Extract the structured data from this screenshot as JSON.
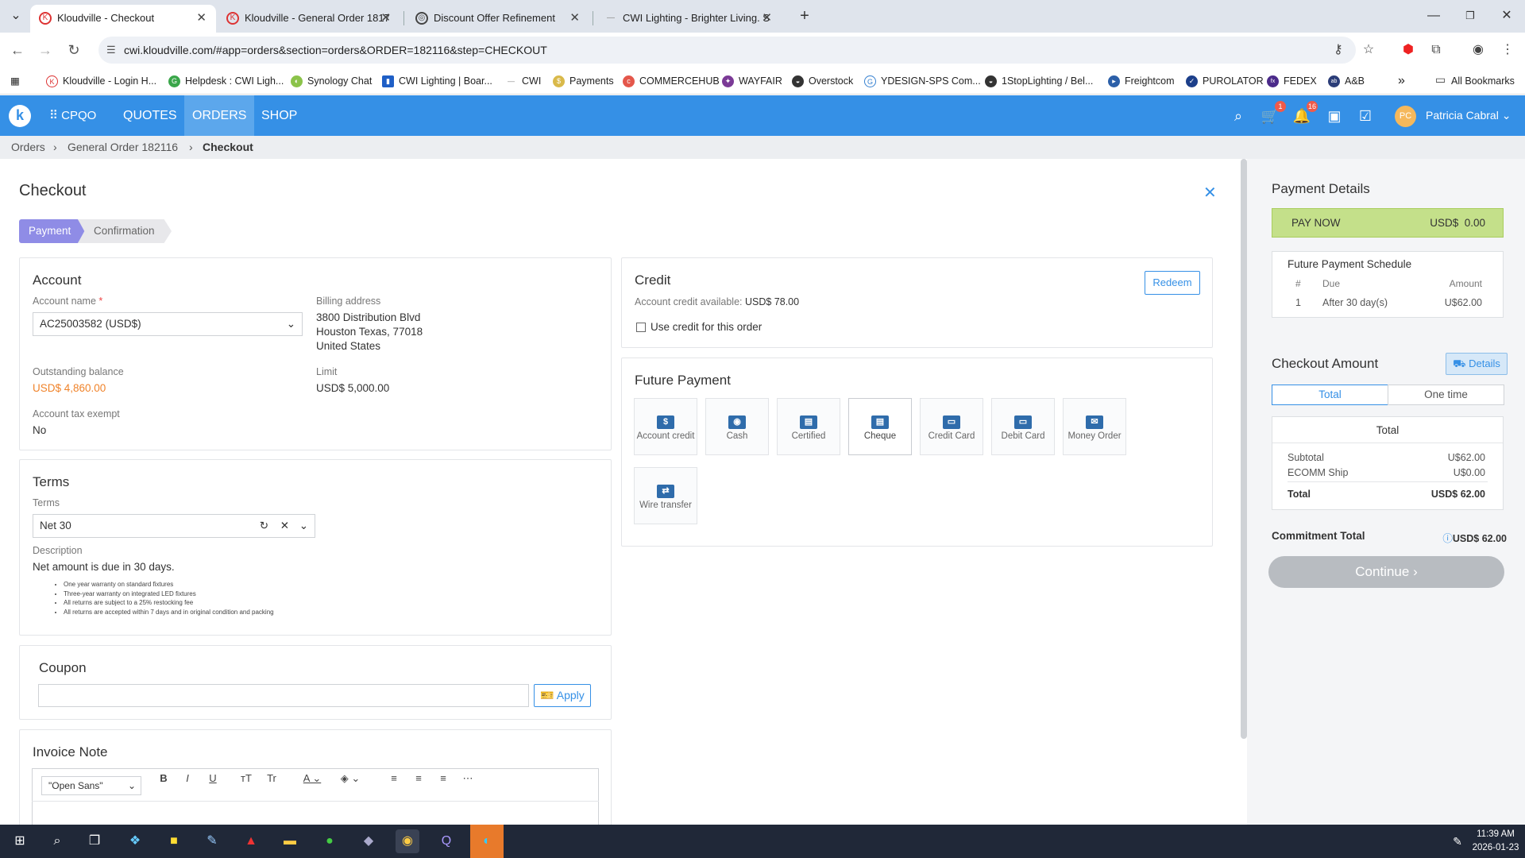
{
  "browser": {
    "tabs": [
      {
        "title": "Kloudville - Checkout",
        "active": true
      },
      {
        "title": "Kloudville - General Order 1817",
        "active": false
      },
      {
        "title": "Discount Offer Refinement",
        "active": false
      },
      {
        "title": "CWI Lighting - Brighter Living. S",
        "active": false
      }
    ],
    "url": "cwi.kloudville.com/#app=orders&section=orders&ORDER=182116&step=CHECKOUT",
    "bookmarks": [
      "Kloudville - Login H...",
      "Helpdesk : CWI Ligh...",
      "Synology Chat",
      "CWI Lighting | Boar...",
      "CWI",
      "Payments",
      "COMMERCEHUB",
      "WAYFAIR",
      "Overstock",
      "YDESIGN-SPS Com...",
      "1StopLighting / Bel...",
      "Freightcom",
      "PUROLATOR",
      "FEDEX",
      "A&B"
    ],
    "all_bookmarks": "All Bookmarks"
  },
  "appnav": {
    "brand": "CPQO",
    "items": [
      "QUOTES",
      "ORDERS",
      "SHOP"
    ],
    "active": "ORDERS",
    "cart_count": "1",
    "notif_count": "16",
    "user_initials": "PC",
    "user_name": "Patricia Cabral"
  },
  "breadcrumb": {
    "orders": "Orders",
    "order": "General Order 182116",
    "current": "Checkout"
  },
  "page": {
    "title": "Checkout"
  },
  "steps": {
    "payment": "Payment",
    "confirmation": "Confirmation"
  },
  "account": {
    "title": "Account",
    "account_name_label": "Account name",
    "required_mark": "*",
    "account_name_value": "AC25003582 (USD$)",
    "billing_label": "Billing address",
    "billing_lines": [
      "3800 Distribution Blvd",
      "Houston Texas, 77018",
      "United States"
    ],
    "outstanding_label": "Outstanding balance",
    "outstanding_value": "USD$ 4,860.00",
    "limit_label": "Limit",
    "limit_value": "USD$ 5,000.00",
    "tax_exempt_label": "Account tax exempt",
    "tax_exempt_value": "No"
  },
  "terms": {
    "title": "Terms",
    "terms_label": "Terms",
    "terms_value": "Net 30",
    "description_label": "Description",
    "description_value": "Net amount is due in 30 days.",
    "bullets": [
      "One year warranty on standard fixtures",
      "Three-year warranty on integrated LED fixtures",
      "All returns are subject to a 25% restocking fee",
      "All returns are accepted within 7 days and in original condition and packing"
    ]
  },
  "coupon": {
    "title": "Coupon",
    "value": "",
    "apply_label": "Apply"
  },
  "invoice_note": {
    "title": "Invoice Note",
    "font": "\"Open Sans\""
  },
  "credit": {
    "title": "Credit",
    "redeem_label": "Redeem",
    "available_label": "Account credit available:",
    "available_value": "USD$ 78.00",
    "use_credit_label": "Use credit for this order"
  },
  "future_payment": {
    "title": "Future Payment",
    "methods": [
      "Account credit",
      "Cash",
      "Certified",
      "Cheque",
      "Credit Card",
      "Debit Card",
      "Money Order",
      "Wire transfer"
    ],
    "selected": "Cheque"
  },
  "sidebar": {
    "payment_details_title": "Payment Details",
    "pay_now_label": "PAY NOW",
    "pay_now_value": "USD$  0.00",
    "schedule_title": "Future Payment Schedule",
    "schedule_headers": [
      "#",
      "Due",
      "Amount"
    ],
    "schedule_rows": [
      [
        "1",
        "After 30 day(s)",
        "U$62.00"
      ]
    ],
    "checkout_amount_title": "Checkout Amount",
    "details_label": "Details",
    "seg_total": "Total",
    "seg_onetime": "One time",
    "total_card_title": "Total",
    "subtotal_label": "Subtotal",
    "subtotal_value": "U$62.00",
    "ship_label": "ECOMM Ship",
    "ship_value": "U$0.00",
    "total_label": "Total",
    "total_value": "USD$ 62.00",
    "commitment_label": "Commitment Total",
    "commitment_value": "USD$ 62.00",
    "continue_label": "Continue"
  },
  "taskbar": {
    "time": "11:39 AM",
    "date": "2026-01-23"
  }
}
